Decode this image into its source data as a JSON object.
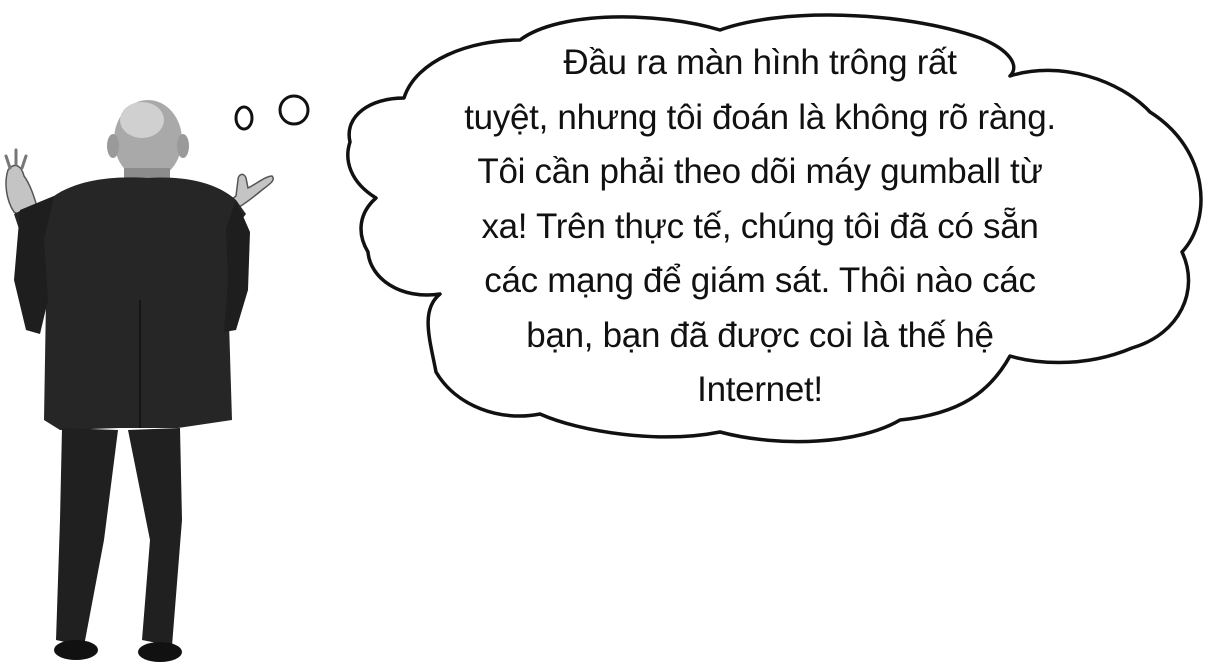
{
  "thought_bubble": {
    "lines": [
      "Đầu ra màn hình trông rất",
      "tuyệt, nhưng tôi đoán là không rõ ràng.",
      "Tôi cần phải theo dõi máy gumball từ",
      "xa! Trên thực tế, chúng tôi đã có sẵn",
      "các mạng để giám sát. Thôi nào các",
      "bạn, bạn đã được coi là thế hệ",
      "Internet!"
    ]
  },
  "colors": {
    "background": "#ffffff",
    "outline": "#111111",
    "suit": "#262626",
    "skin": "#bdbdbd"
  }
}
